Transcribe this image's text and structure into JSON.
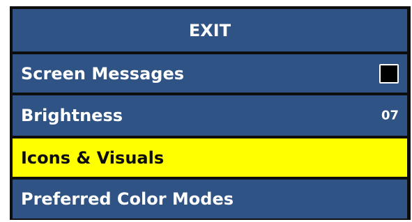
{
  "menu": {
    "exit_label": "EXIT",
    "items": [
      {
        "label": "Screen Messages",
        "control": "checkbox",
        "checked": false
      },
      {
        "label": "Brightness",
        "value": "07"
      },
      {
        "label": "Icons & Visuals",
        "selected": true
      },
      {
        "label": "Preferred Color Modes"
      }
    ]
  },
  "colors": {
    "row_background": "#2e5384",
    "row_text": "#ffffff",
    "selected_background": "#ffff00",
    "selected_text": "#0d0d0d",
    "divider": "#0d0d0d"
  }
}
